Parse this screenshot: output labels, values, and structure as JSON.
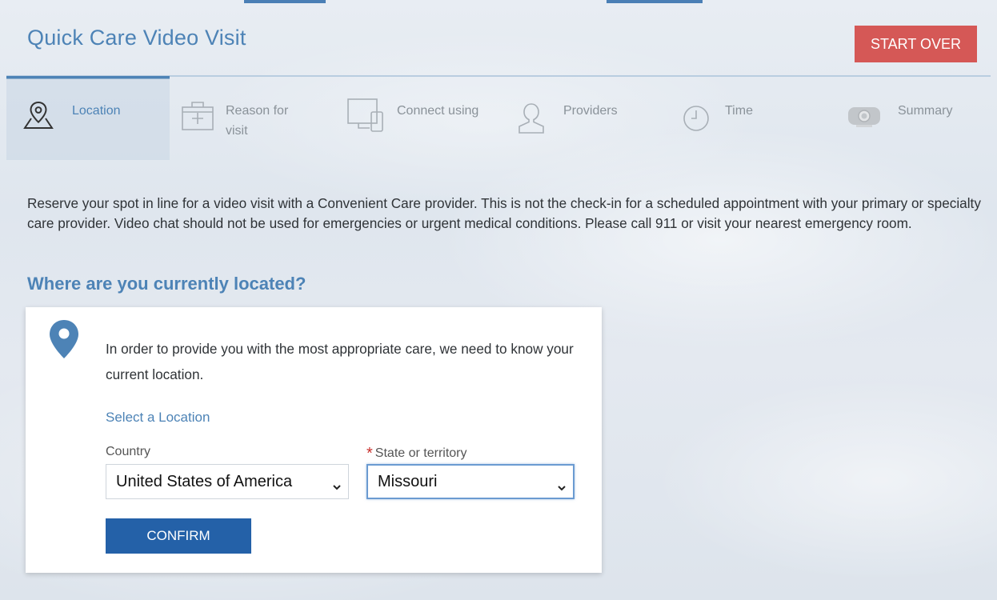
{
  "header": {
    "title": "Quick Care Video Visit",
    "start_over_label": "START OVER"
  },
  "steps": [
    {
      "id": "location",
      "label": "Location",
      "icon": "map-pin-icon",
      "active": true
    },
    {
      "id": "reason",
      "label": "Reason for visit",
      "icon": "medical-kit-icon",
      "active": false
    },
    {
      "id": "connect",
      "label": "Connect using",
      "icon": "devices-icon",
      "active": false
    },
    {
      "id": "providers",
      "label": "Providers",
      "icon": "person-icon",
      "active": false
    },
    {
      "id": "time",
      "label": "Time",
      "icon": "clock-icon",
      "active": false
    },
    {
      "id": "summary",
      "label": "Summary",
      "icon": "camera-icon",
      "active": false
    }
  ],
  "intro": "Reserve your spot in line for a video visit with a Convenient Care provider. This is not the check-in for a scheduled appointment with your primary or specialty care provider. Video chat should not be used for emergencies or urgent medical conditions. Please call 911 or visit your nearest emergency room.",
  "question": "Where are you currently located?",
  "card": {
    "text": "In order to provide you with the most appropriate care, we need to know your current location.",
    "select_location": "Select a Location",
    "country_label": "Country",
    "country_value": "United States of America",
    "state_label": "State or territory",
    "state_required": "*",
    "state_value": "Missouri",
    "confirm_label": "CONFIRM"
  },
  "colors": {
    "accent": "#4d83b6",
    "danger": "#d55856",
    "primary_button": "#2461a8"
  }
}
